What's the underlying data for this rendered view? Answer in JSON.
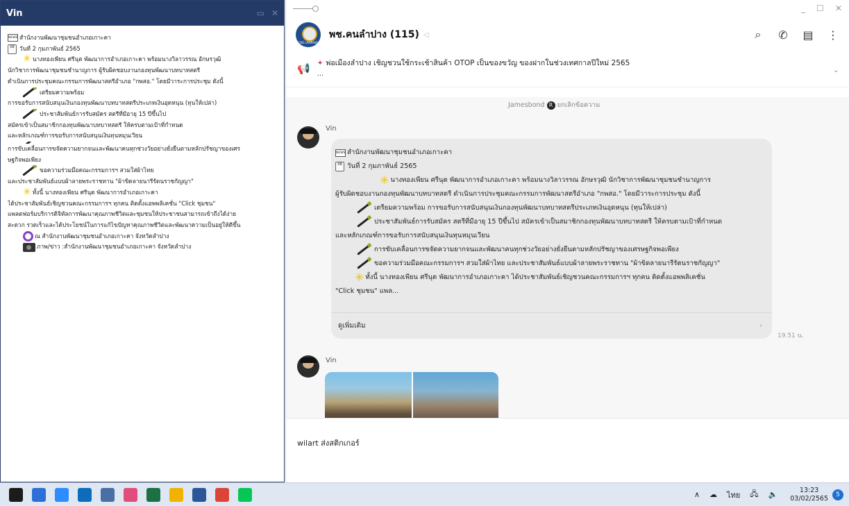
{
  "note_window": {
    "title": "Vin",
    "lines": [
      "สำนักงานพัฒนาชุมชนอำเภอเกาะคา",
      "วันที่ 2 กุมภาพันธ์ 2565",
      "นางทองเพียน ศรีนุต พัฒนาการอำเภอเกาะคา พร้อมนางวิลาวรรณ อักษรวุฒิ",
      "นักวิชาการพัฒนาชุมชนชำนาญการ ผู้รับผิดชอบงานกองทุนพัฒนาบทบาทสตรี",
      "ดำเนินการประชุมคณะกรรมการพัฒนาสตรีอำเภอ \"กพสอ.\" โดยมีวาระการประชุม ดังนี้",
      "เตรียมความพร้อม",
      "การขอรับการสนับสนุนเงินกองทุนพัฒนาบทบาทสตรีประเภทเงินอุดหนุน (ทุนให้เปล่า)",
      "ประชาสัมพันธ์การรับสมัคร สตรีที่มีอายุ 15 ปีขึ้นไป",
      "สมัครเข้าเป็นสมาชิกกองทุนพัฒนาบทบาทสตรี ให้ครบตามเป้าที่กำหนด",
      "และหลักเกณฑ์การขอรับการสนับสนุนเงินทุนหมุนเวียน",
      "การขับเคลื่อนการขจัดความยากจนและพัฒนาคนทุกช่วงวัยอย่างยั่งยืนตามหลักปรัชญาของเศร",
      "ษฐกิจพอเพียง",
      "ขอความร่วมมือคณะกรรมการฯ สวมใส่ผ้าไทย",
      "และประชาสัมพันธ์แบบผ้าลายพระราชทาน \"ผ้าขิดลายนารีรัตนราชกัญญา\"",
      "ทั้งนี้ นางทองเพียน ศรีนุต พัฒนาการอำเภอเกาะคา",
      "ได้ประชาสัมพันธ์เชิญชวนคณะกรรมการฯ ทุกคน ติดตั้งแอพพลิเคชั่น \"Click ชุมชน\"",
      "แพลตฟอร์มบริการดิจิทัลการพัฒนาคุณภาพชีวิตและชุมชนให้ประชาชนสามารถเข้าถึงได้ง่าย",
      "สะดวก รวดเร็วและได้ประโยชน์ในการแก้ไขปัญหาคุณภาพชีวิตและพัฒนาความเป็นอยู่ให้ดีขึ้น",
      "ณ สำนักงานพัฒนาชุมชนอำเภอเกาะคา จังหวัดลำปาง",
      "ภาพ/ข่าว :สำนักงานพัฒนาชุมชนอำเภอเกาะคา จังหวัดลำปาง"
    ],
    "news_icon_text": "NEWS",
    "cal_icon_text": "08"
  },
  "chat": {
    "group_name": "พช.คนลำปาง (115)",
    "group_logo_text": "CDD LAMPANG",
    "announcement": "พ่อเมืองลำปาง เชิญชวนใช้กระเช้าสินค้า OTOP เป็นของขวัญ ของฝากในช่วงเทศกาลปีใหม่ 2565",
    "announcement_more": "...",
    "system_message_name": "Jamesbond",
    "system_message_reg": "R",
    "system_message_text": "ยกเลิกข้อความ",
    "sender_1": "Vin",
    "sender_2": "Vin",
    "bubble_lines": [
      "สำนักงานพัฒนาชุมชนอำเภอเกาะคา",
      "วันที่ 2 กุมภาพันธ์ 2565",
      "นางทองเพียน ศรีนุต พัฒนาการอำเภอเกาะคา พร้อมนางวิลาวรรณ อักษรวุฒิ นักวิชาการพัฒนาชุมชนชำนาญการ",
      "ผู้รับผิดชอบงานกองทุนพัฒนาบทบาทสตรี ดำเนินการประชุมคณะกรรมการพัฒนาสตรีอำเภอ \"กพสอ.\" โดยมีวาระการประชุม ดังนี้",
      "เตรียมความพร้อม การขอรับการสนับสนุนเงินกองทุนพัฒนาบทบาทสตรีประเภทเงินอุดหนุน (ทุนให้เปล่า)",
      "ประชาสัมพันธ์การรับสมัคร สตรีที่มีอายุ 15 ปีขึ้นไป สมัครเข้าเป็นสมาชิกกองทุนพัฒนาบทบาทสตรี ให้ครบตามเป้าที่กำหนด",
      "และหลักเกณฑ์การขอรับการสนับสนุนเงินทุนหมุนเวียน",
      "การขับเคลื่อนการขจัดความยากจนและพัฒนาคนทุกช่วงวัยอย่างยั่งยืนตามหลักปรัชญาของเศรษฐกิจพอเพียง",
      "ขอความร่วมมือคณะกรรมการฯ สวมใส่ผ้าไทย และประชาสัมพันธ์แบบผ้าลายพระราชทาน \"ผ้าขิดลายนารีรัตนราชกัญญา\"",
      "ทั้งนี้ นางทองเพียน ศรีนุต พัฒนาการอำเภอเกาะคา ได้ประชาสัมพันธ์เชิญชวนคณะกรรมการฯ ทุกคน ติดตั้งแอพพลิเคชั่น",
      "\"Click ชุมชน\" แพล..."
    ],
    "see_more": "ดูเพิ่มเติม",
    "time": "19.51 น.",
    "input_text": "wilart ส่งสติกเกอร์"
  },
  "taskbar": {
    "lang": "ไทย",
    "time": "13:23",
    "date": "03/02/2565",
    "notifications": "5",
    "apps": [
      {
        "name": "start",
        "color": "#1b1b1b"
      },
      {
        "name": "task-view",
        "color": "#2d6fd6"
      },
      {
        "name": "zoom",
        "color": "#2d8cff"
      },
      {
        "name": "mail",
        "color": "#0f6cbd"
      },
      {
        "name": "calculator",
        "color": "#4a6fa5"
      },
      {
        "name": "snipping",
        "color": "#e24e7c"
      },
      {
        "name": "excel",
        "color": "#1d7044"
      },
      {
        "name": "file-explorer",
        "color": "#f0b400"
      },
      {
        "name": "word",
        "color": "#2b5797"
      },
      {
        "name": "chrome",
        "color": "#db4437"
      },
      {
        "name": "line",
        "color": "#06c755"
      }
    ]
  },
  "colors": {
    "note_titlebar": "#243b67",
    "bubble": "#e9e9e9",
    "chat_bg": "#f7f7f7",
    "taskbar": "#dfe7f3"
  }
}
